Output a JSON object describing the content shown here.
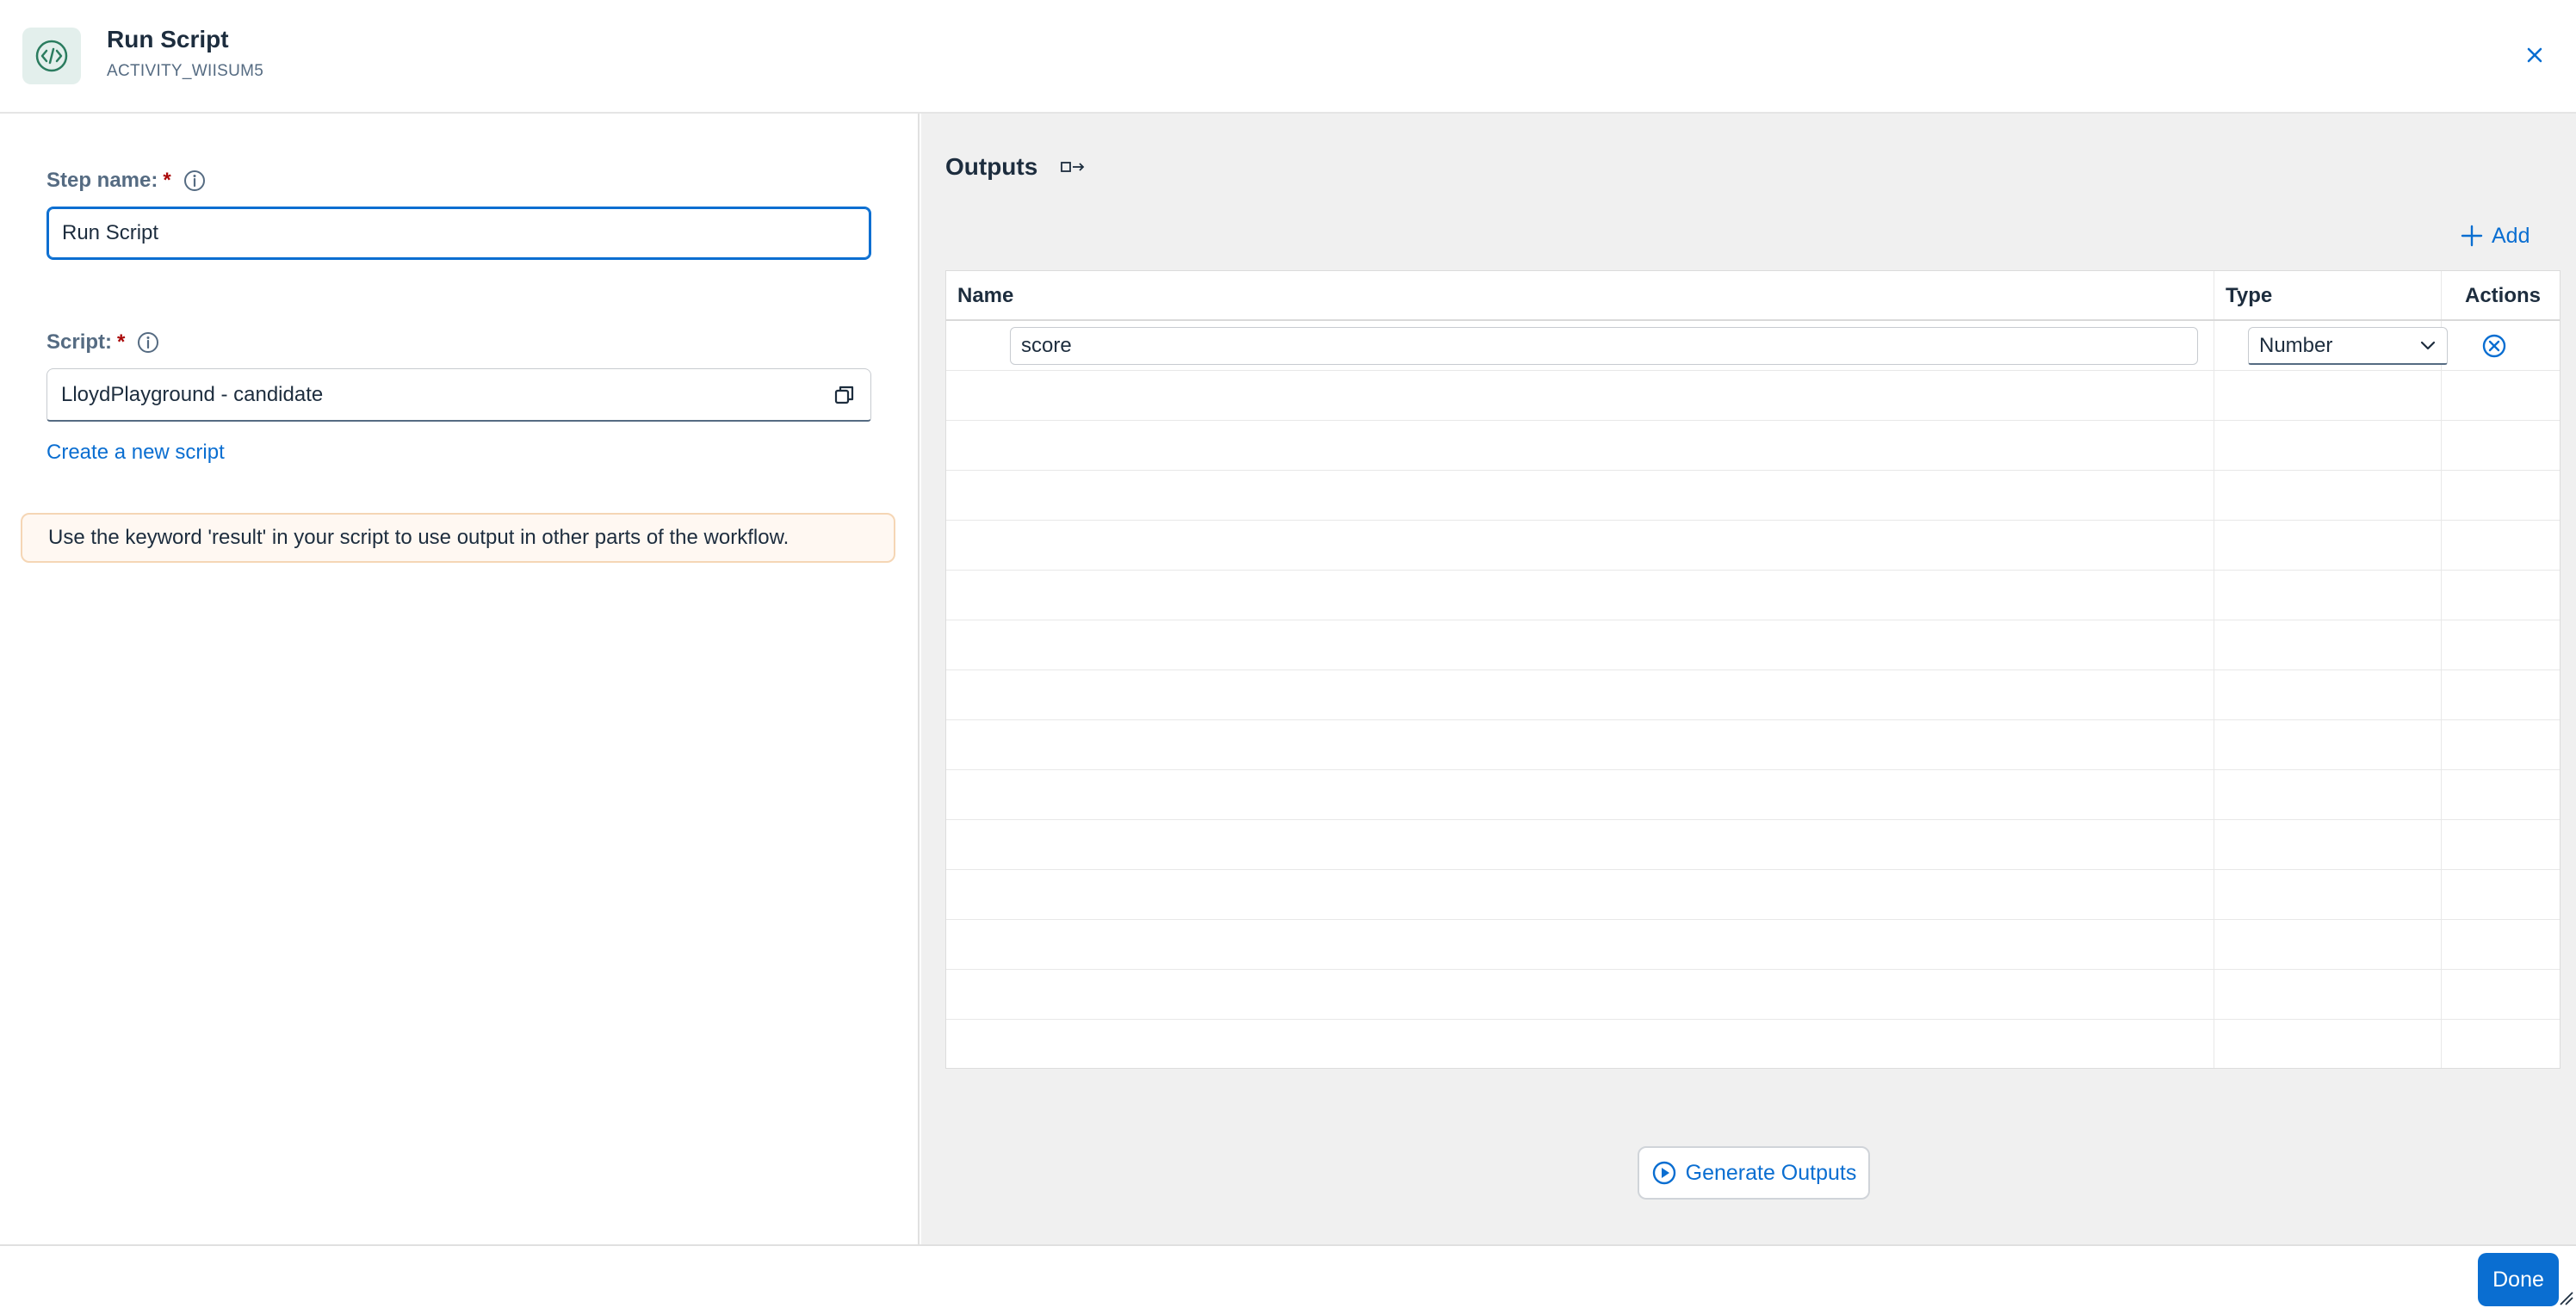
{
  "header": {
    "title": "Run Script",
    "subtitle": "ACTIVITY_WIISUM5",
    "icon": "code-icon",
    "close_icon": "close-icon"
  },
  "form": {
    "step_name": {
      "label": "Step name:",
      "required_marker": "*",
      "value": "Run Script"
    },
    "script": {
      "label": "Script:",
      "required_marker": "*",
      "value": "LloydPlayground - candidate",
      "value_help_icon": "copy-icon"
    },
    "create_link": "Create a new script",
    "info_message": "Use the keyword 'result' in your script to use output in other parts of the workflow."
  },
  "outputs": {
    "title": "Outputs",
    "add_label": "Add",
    "columns": [
      "Name",
      "Type",
      "Actions"
    ],
    "rows": [
      {
        "name": "score",
        "type": "Number"
      }
    ],
    "generate_label": "Generate Outputs"
  },
  "footer": {
    "done_label": "Done"
  },
  "colors": {
    "accent": "#0a6ed1",
    "required": "#aa0808",
    "panel_bg": "#f0f0f0",
    "message_bg": "#fff8f2",
    "icon_bg": "#e3efec",
    "icon_fg": "#2b7c5f"
  }
}
